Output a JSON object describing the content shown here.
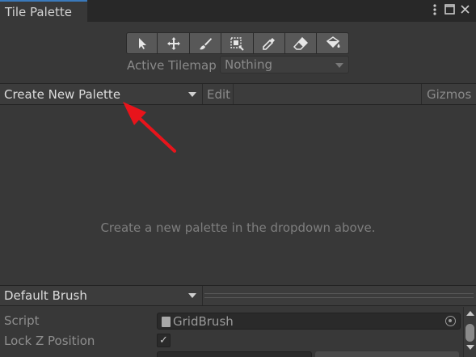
{
  "window": {
    "tab_title": "Tile Palette",
    "menu_icon": "kebab-menu-icon",
    "maximize_icon": "maximize-icon",
    "close_icon": "close-icon"
  },
  "toolbar": {
    "tools": [
      {
        "name": "select-tool",
        "icon": "select-arrow-icon"
      },
      {
        "name": "move-tool",
        "icon": "move-icon"
      },
      {
        "name": "paint-tool",
        "icon": "paintbrush-icon"
      },
      {
        "name": "box-fill-tool",
        "icon": "box-fill-icon"
      },
      {
        "name": "pick-tool",
        "icon": "eyedropper-icon"
      },
      {
        "name": "erase-tool",
        "icon": "eraser-icon"
      },
      {
        "name": "flood-fill-tool",
        "icon": "paint-bucket-icon"
      }
    ]
  },
  "active_tilemap": {
    "label": "Active Tilemap",
    "value": "Nothing"
  },
  "palette_bar": {
    "dropdown_label": "Create New Palette",
    "edit_label": "Edit",
    "gizmos_label": "Gizmos"
  },
  "palette_area": {
    "empty_message": "Create a new palette in the dropdown above."
  },
  "annotation": {
    "color": "#e8141b",
    "icon": "red-arrow-icon"
  },
  "brush_bar": {
    "dropdown_label": "Default Brush"
  },
  "inspector": {
    "script_label": "Script",
    "script_value": "GridBrush",
    "lock_z_label": "Lock Z Position",
    "lock_z_checked": true,
    "checkmark": "✓"
  },
  "colors": {
    "background": "#383838",
    "tab_accent": "#3a79bb"
  }
}
